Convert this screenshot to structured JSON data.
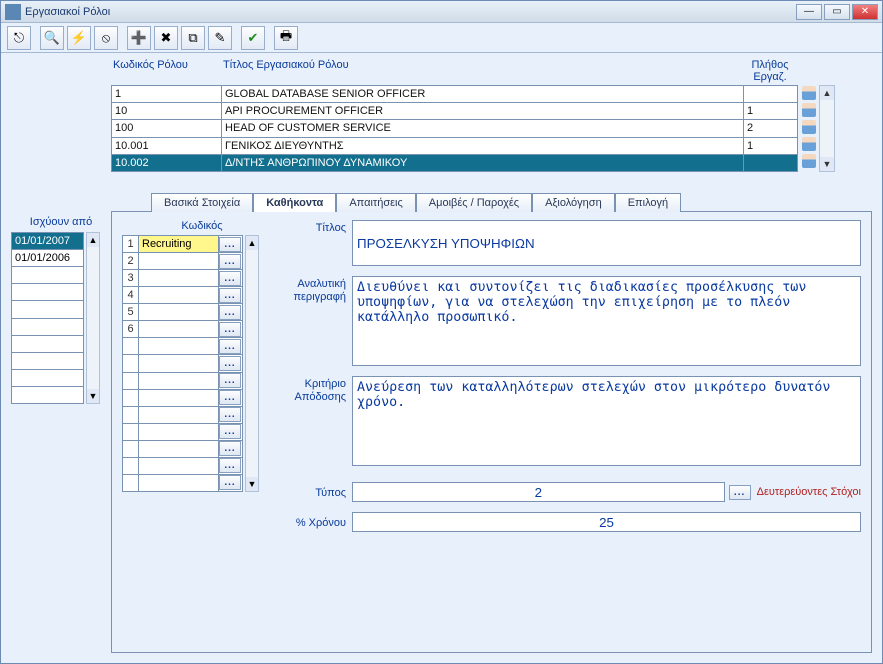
{
  "window": {
    "title": "Εργασιακοί Ρόλοι"
  },
  "roles": {
    "headers": {
      "code": "Κωδικός Ρόλου",
      "title": "Τίτλος Εργασιακού Ρόλου",
      "count": "Πλήθος Εργαζ."
    },
    "rows": [
      {
        "code": "1",
        "title": "GLOBAL DATABASE SENIOR OFFICER",
        "count": ""
      },
      {
        "code": "10",
        "title": "API PROCUREMENT OFFICER",
        "count": "1"
      },
      {
        "code": "100",
        "title": "HEAD OF CUSTOMER SERVICE",
        "count": "2"
      },
      {
        "code": "10.001",
        "title": "ΓΕΝΙΚΟΣ ΔΙΕΥΘΥΝΤΗΣ",
        "count": "1"
      },
      {
        "code": "10.002",
        "title": "Δ/ΝΤΗΣ ΑΝΘΡΩΠΙΝΟΥ ΔΥΝΑΜΙΚΟΥ",
        "count": ""
      }
    ],
    "selected_index": 4
  },
  "effective_dates": {
    "label": "Ισχύουν από",
    "rows": [
      "01/01/2007",
      "01/01/2006",
      "",
      "",
      "",
      "",
      "",
      "",
      "",
      ""
    ],
    "selected_index": 0
  },
  "tabs": {
    "items": [
      "Βασικά Στοιχεία",
      "Καθήκοντα",
      "Απαιτήσεις",
      "Αμοιβές / Παροχές",
      "Αξιολόγηση",
      "Επιλογή"
    ],
    "active_index": 1
  },
  "tasks": {
    "header": "Κωδικός",
    "rows": [
      {
        "idx": "1",
        "name": "Recruiting",
        "selected": true
      },
      {
        "idx": "2",
        "name": ""
      },
      {
        "idx": "3",
        "name": ""
      },
      {
        "idx": "4",
        "name": ""
      },
      {
        "idx": "5",
        "name": ""
      },
      {
        "idx": "6",
        "name": ""
      },
      {
        "idx": "",
        "name": ""
      },
      {
        "idx": "",
        "name": ""
      },
      {
        "idx": "",
        "name": ""
      },
      {
        "idx": "",
        "name": ""
      },
      {
        "idx": "",
        "name": ""
      },
      {
        "idx": "",
        "name": ""
      },
      {
        "idx": "",
        "name": ""
      },
      {
        "idx": "",
        "name": ""
      },
      {
        "idx": "",
        "name": ""
      }
    ]
  },
  "details": {
    "labels": {
      "title": "Τίτλος",
      "desc": "Αναλυτική περιγραφή",
      "criterion": "Κριτήριο Απόδοσης",
      "type": "Τύπος",
      "subtargets": "Δευτερεύοντες Στόχοι",
      "time_pct": "% Χρόνου"
    },
    "values": {
      "title": "ΠΡΟΣΕΛΚΥΣΗ ΥΠΟΨΗΦΙΩΝ",
      "desc": "Διευθύνει και συντονίζει τις διαδικασίες προσέλκυσης των υποψηφίων, για να στελεχώση την επιχείρηση με το πλεόν κατάλληλο προσωπικό.",
      "criterion": "Ανεύρεση των καταλληλότερων στελεχών στον μικρότερο δυνατόν χρόνο.",
      "type": "2",
      "time_pct": "25"
    }
  }
}
